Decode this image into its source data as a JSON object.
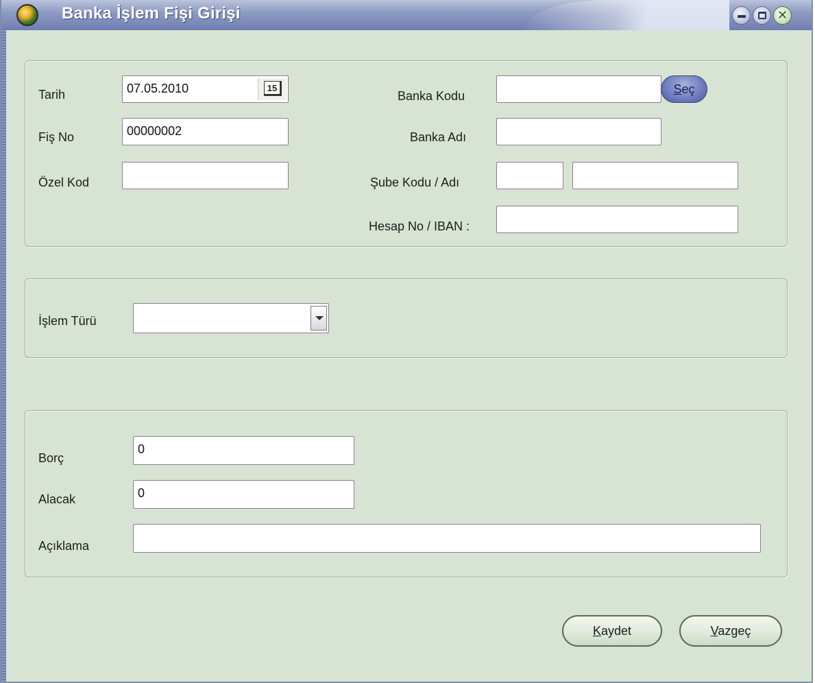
{
  "window": {
    "title": "Banka İşlem Fişi Girişi"
  },
  "header_group": {
    "tarih_label": "Tarih",
    "tarih_value": "07.05.2010",
    "calendar_icon_text": "15",
    "fis_no_label": "Fiş No",
    "fis_no_value": "00000002",
    "ozel_kod_label": "Özel Kod",
    "ozel_kod_value": "",
    "banka_kodu_label": "Banka Kodu",
    "banka_kodu_value": "",
    "sec_button_first": "S",
    "sec_button_rest": "eç",
    "banka_adi_label": "Banka Adı",
    "banka_adi_value": "",
    "sube_label": "Şube Kodu / Adı",
    "sube_kodu_value": "",
    "sube_adi_value": "",
    "hesap_label": "Hesap No / IBAN :",
    "hesap_value": ""
  },
  "islem_group": {
    "islem_turu_label": "İşlem Türü",
    "islem_turu_selected": ""
  },
  "amount_group": {
    "borc_label": "Borç",
    "borc_value": "0",
    "alacak_label": "Alacak",
    "alacak_value": "0",
    "aciklama_label": "Açıklama",
    "aciklama_value": ""
  },
  "footer": {
    "kaydet_first": "K",
    "kaydet_rest": "aydet",
    "vazgec_first": "V",
    "vazgec_rest": "azgeç"
  },
  "icons": {
    "app": "globe-app-icon",
    "minimize": "minimize-icon",
    "maximize": "maximize-icon",
    "close": "close-icon",
    "calendar": "calendar-icon",
    "dropdown": "chevron-down-icon"
  },
  "colors": {
    "window_bg": "#d7e4d3",
    "titlebar": "#6e7eb1",
    "title_text": "#ffffff",
    "sec_button": "#6f7fc0"
  }
}
